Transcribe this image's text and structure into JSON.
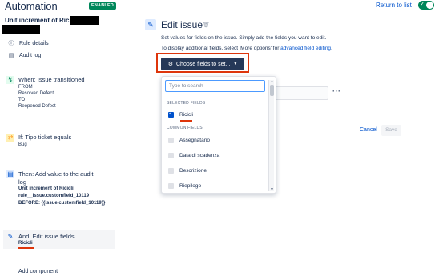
{
  "header": {
    "title": "Automation",
    "status_badge": "ENABLED",
    "return_link": "Return to list"
  },
  "sidebar": {
    "rule_name": "Unit increment of Ricicli-",
    "links": [
      {
        "label": "Rule details",
        "icon": "info-icon"
      },
      {
        "label": "Audit log",
        "icon": "document-icon"
      }
    ],
    "trigger": {
      "title": "When: Issue transitioned",
      "lines": [
        "FROM",
        "Resolved Defect",
        "TO",
        "Reopened Defect"
      ]
    },
    "condition": {
      "title": "If: Tipo ticket equals",
      "lines": [
        "Bug"
      ]
    },
    "audit_action": {
      "title_line1": "Then: Add value to the audit",
      "title_line2": "log",
      "lines": [
        "Unit increment of Ricicli",
        "rule__issue.customfield_10119",
        "BEFORE: {{issue.customfield_10119}}"
      ]
    },
    "edit_action": {
      "title": "And: Edit issue fields",
      "field": "Ricicli"
    },
    "add_component": "Add component"
  },
  "main": {
    "title": "Edit issue",
    "description1": "Set values for fields on the issue. Simply add the fields you want to edit.",
    "description2_prefix": "To display additional fields, select 'More options' for ",
    "description2_link": "advanced field editing",
    "description2_suffix": ".",
    "choose_fields_label": "Choose fields to set...",
    "cancel_label": "Cancel",
    "save_label": "Save"
  },
  "dropdown": {
    "search_placeholder": "Type to search",
    "selected_header": "SELECTED FIELDS",
    "selected": [
      {
        "label": "Ricicli",
        "checked": true
      }
    ],
    "common_header": "COMMON FIELDS",
    "common": [
      {
        "label": "Assegnatario",
        "checked": false
      },
      {
        "label": "Data di scadenza",
        "checked": false
      },
      {
        "label": "Descrizione",
        "checked": false
      },
      {
        "label": "Riepilogo",
        "checked": false
      }
    ]
  },
  "colors": {
    "accent": "#0052cc",
    "enabled_green": "#00875a",
    "button_dark": "#253858",
    "highlight_red": "#de350b"
  }
}
